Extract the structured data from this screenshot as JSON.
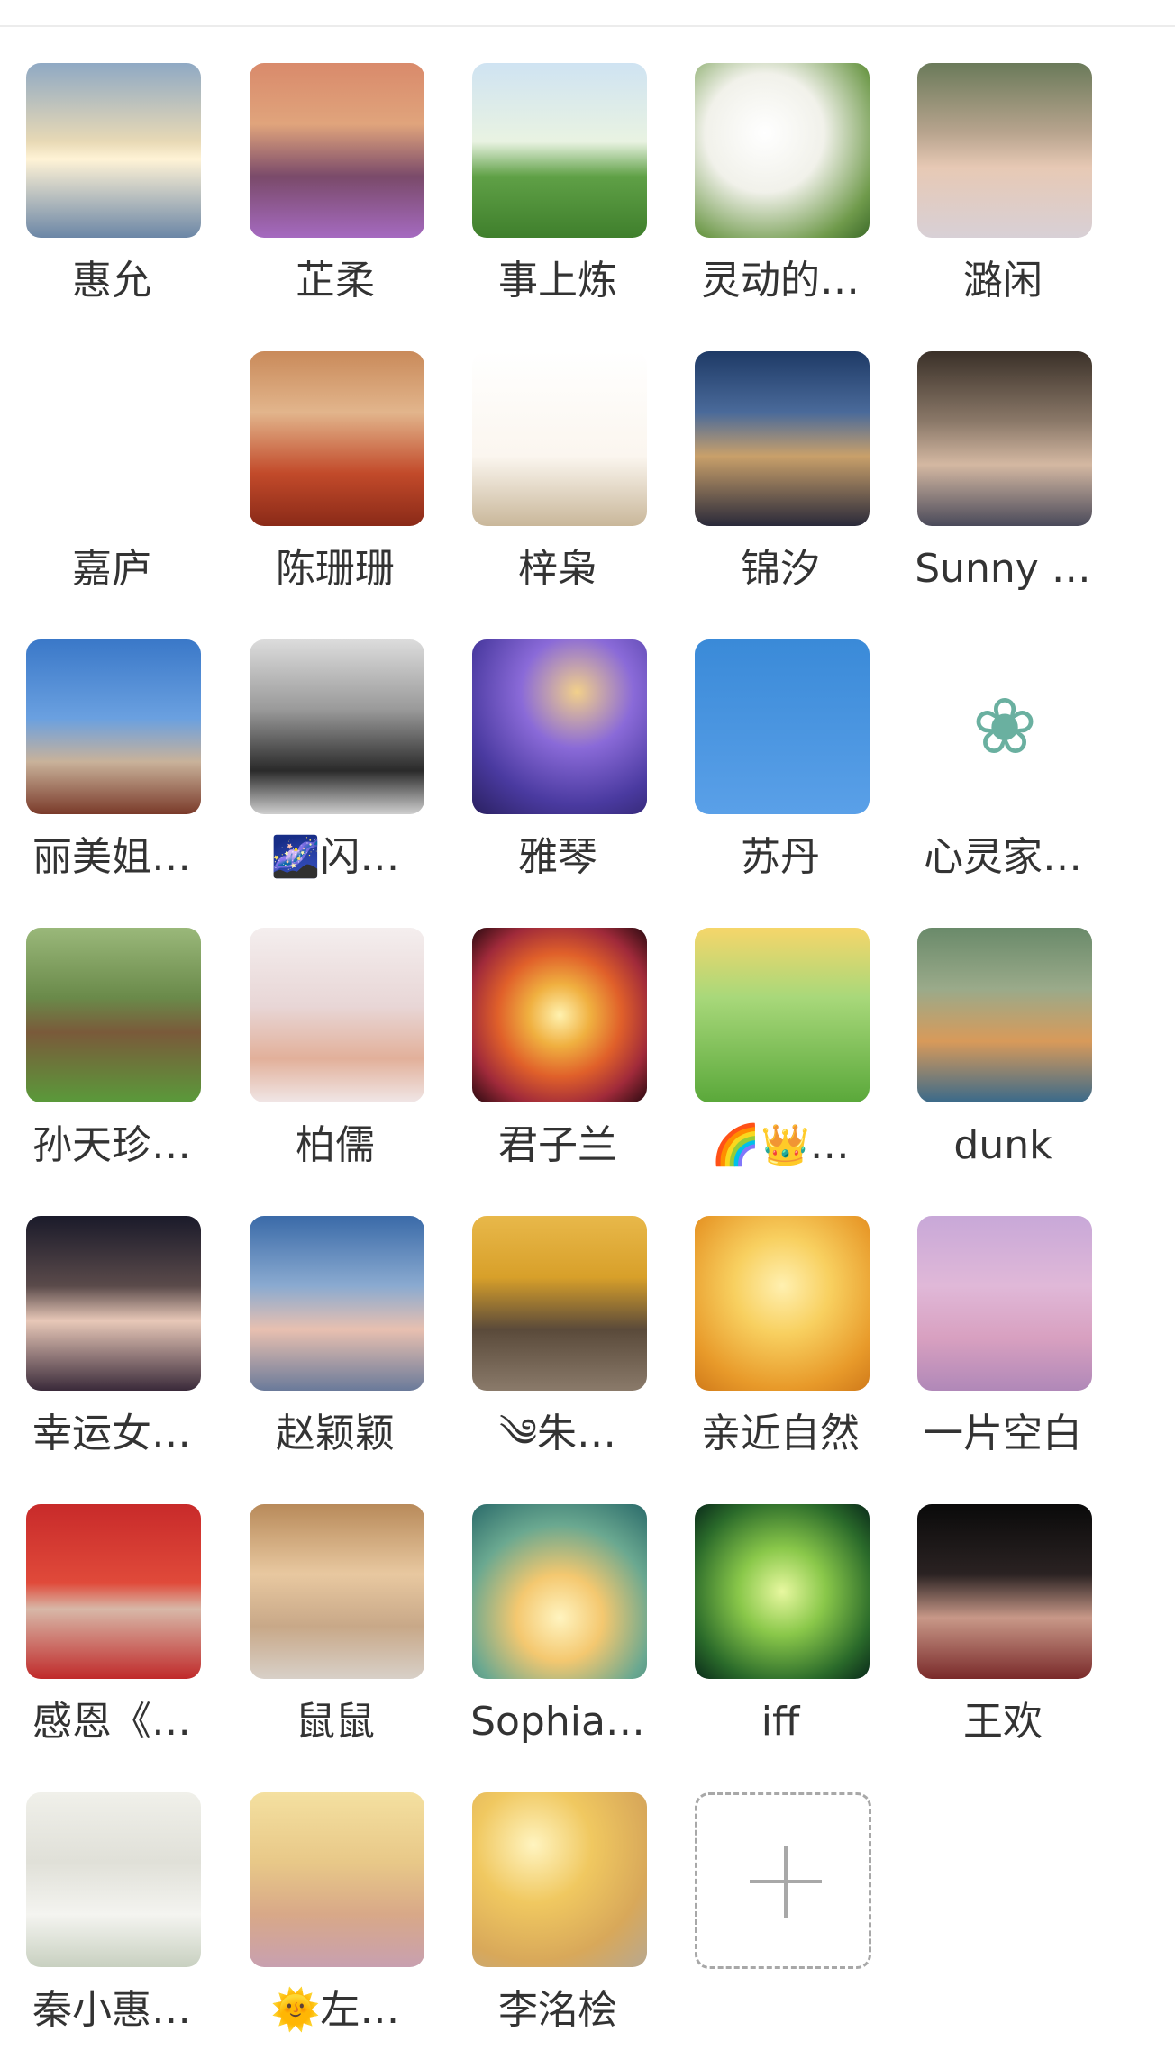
{
  "members": [
    {
      "name": "惠允",
      "icon": "sunlight-clouds-avatar",
      "bg": "linear-gradient(180deg,#8fa9c4 0%,#e8d9b5 45%,#fff3d6 55%,#6b86a6 100%)",
      "glyph": ""
    },
    {
      "name": "芷柔",
      "icon": "woman-sunset-avatar",
      "bg": "linear-gradient(180deg,#d98a6b 0%,#e0a47c 35%,#7a4a6a 65%,#a56ac0 100%)",
      "glyph": ""
    },
    {
      "name": "事上炼",
      "icon": "tree-field-avatar",
      "bg": "linear-gradient(180deg,#cfe3f2 0%,#e9f3e2 45%,#5fa046 65%,#3f7f2c 100%)",
      "glyph": ""
    },
    {
      "name": "灵动的…",
      "icon": "white-flowers-avatar",
      "bg": "radial-gradient(circle at 40% 40%,#ffffff 0%,#f1f1ea 40%,#6f9a4b 80%,#3d6b2a 100%)",
      "glyph": ""
    },
    {
      "name": "潞闲",
      "icon": "woman-portrait-avatar",
      "bg": "linear-gradient(180deg,#6a7a5a 0%,#b8a48e 40%,#e7c9b5 60%,#d8d0d6 100%)",
      "glyph": ""
    },
    {
      "name": "嘉庐",
      "icon": "green-trees-avatar",
      "bg": "linear-gradient(180deg,#ffffff 0%,#ffffff 100%)",
      "glyph": ""
    },
    {
      "name": "陈珊珊",
      "icon": "woman-red-scarf-avatar",
      "bg": "linear-gradient(180deg,#c98a5a 0%,#e2b58c 35%,#c24a2a 70%,#8a2a18 100%)",
      "glyph": ""
    },
    {
      "name": "梓枭",
      "icon": "cartoon-girl-avatar",
      "bg": "linear-gradient(180deg,#ffffff 0%,#fbf6ef 60%,#c9b79a 100%)",
      "glyph": ""
    },
    {
      "name": "锦汐",
      "icon": "mountain-night-avatar",
      "bg": "linear-gradient(180deg,#1e3a66 0%,#4a6a9a 35%,#c9a06a 60%,#2a2a3a 100%)",
      "glyph": ""
    },
    {
      "name": "Sunny …",
      "icon": "woman-glasses-avatar",
      "bg": "linear-gradient(180deg,#3a3028 0%,#8a7868 40%,#d4b8a2 65%,#4a4a5a 100%)",
      "glyph": ""
    },
    {
      "name": "丽美姐…",
      "icon": "woman-sky-avatar",
      "bg": "linear-gradient(180deg,#3a78c8 0%,#6aa0e0 45%,#c9b29a 70%,#7a3a2a 100%)",
      "glyph": ""
    },
    {
      "name": "🌌闪…",
      "icon": "woman-monochrome-avatar",
      "bg": "linear-gradient(180deg,#dcdcdc 0%,#9a9a9a 40%,#2a2a2a 75%,#cfcfcf 100%)",
      "glyph": ""
    },
    {
      "name": "雅琴",
      "icon": "purple-galaxy-avatar",
      "bg": "radial-gradient(circle at 60% 30%,#f2d08a 0%,#8a6ad8 35%,#4a3aa0 70%,#2a2060 100%)",
      "glyph": ""
    },
    {
      "name": "苏丹",
      "icon": "mother-child-cartoon-avatar",
      "bg": "linear-gradient(180deg,#3a8ad8 0%,#5aa0e8 100%)",
      "glyph": ""
    },
    {
      "name": "心灵家…",
      "icon": "flower-of-life-logo-avatar",
      "bg": "linear-gradient(180deg,#ffffff 0%,#ffffff 100%)",
      "glyph": "❀"
    },
    {
      "name": "孙天珍…",
      "icon": "wooden-house-garden-avatar",
      "bg": "linear-gradient(180deg,#9ab87a 0%,#6a8a4a 40%,#7a5a3a 60%,#5a9a3a 100%)",
      "glyph": ""
    },
    {
      "name": "柏儒",
      "icon": "woman-hanfu-fan-avatar",
      "bg": "linear-gradient(180deg,#f4eeee 0%,#e8d6d6 45%,#e2b09a 75%,#f0e6e6 100%)",
      "glyph": ""
    },
    {
      "name": "君子兰",
      "icon": "mandala-avatar",
      "bg": "radial-gradient(circle at 50% 50%,#fff2b0 0%,#f0b040 25%,#e0602a 50%,#a02a3a 75%,#2a0a10 100%)",
      "glyph": ""
    },
    {
      "name": "🌈👑…",
      "icon": "meditating-girl-avatar",
      "bg": "linear-gradient(180deg,#f6d66a 0%,#a8d87a 40%,#5aa83a 100%)",
      "glyph": ""
    },
    {
      "name": "dunk",
      "icon": "corgi-dog-avatar",
      "bg": "linear-gradient(180deg,#6a8a6a 0%,#9aaa8a 35%,#d89a5a 65%,#3a6a8a 100%)",
      "glyph": ""
    },
    {
      "name": "幸运女…",
      "icon": "cartoon-girl-night-avatar",
      "bg": "linear-gradient(180deg,#1a1a2a 0%,#5a4a4a 40%,#e8c8b8 60%,#3a2a3a 100%)",
      "glyph": ""
    },
    {
      "name": "赵颖颖",
      "icon": "sea-pier-avatar",
      "bg": "linear-gradient(180deg,#3a6aa8 0%,#8aaad0 40%,#e8c0b0 65%,#6a7a9a 100%)",
      "glyph": ""
    },
    {
      "name": "༄朱…",
      "icon": "ginkgo-tree-woman-avatar",
      "bg": "linear-gradient(180deg,#e8b84a 0%,#d8a02a 35%,#5a4a3a 65%,#8a7a6a 100%)",
      "glyph": ""
    },
    {
      "name": "亲近自然",
      "icon": "laughing-girl-avatar",
      "bg": "radial-gradient(circle at 50% 40%,#fff0b0 0%,#f8d060 35%,#e89a2a 75%,#d07a1a 100%)",
      "glyph": ""
    },
    {
      "name": "一片空白",
      "icon": "sleeping-baby-avatar",
      "bg": "linear-gradient(180deg,#c8a8d8 0%,#e0b8d8 40%,#d8a0c0 70%,#b088b8 100%)",
      "glyph": ""
    },
    {
      "name": "感恩《…",
      "icon": "woman-red-flag-avatar",
      "bg": "linear-gradient(180deg,#c82a2a 0%,#e04a3a 45%,#d8b8a8 60%,#c02a2a 100%)",
      "glyph": ""
    },
    {
      "name": "鼠鼠",
      "icon": "woman-temple-avatar",
      "bg": "linear-gradient(180deg,#b88a5a 0%,#e8c8a0 40%,#c8a888 70%,#d8d0c8 100%)",
      "glyph": ""
    },
    {
      "name": "Sophia…",
      "icon": "goddess-heart-avatar",
      "bg": "radial-gradient(circle at 50% 65%,#fff4c0 0%,#f4c870 30%,#6aa890 65%,#2a6a6a 100%)",
      "glyph": ""
    },
    {
      "name": "iff",
      "icon": "green-lotus-avatar",
      "bg": "radial-gradient(circle at 50% 50%,#e8f8a0 0%,#8ac84a 35%,#2a6a2a 75%,#0a2a1a 100%)",
      "glyph": ""
    },
    {
      "name": "王欢",
      "icon": "woman-black-background-avatar",
      "bg": "linear-gradient(180deg,#0a0a0a 0%,#2a2222 40%,#c89888 65%,#7a2a2a 100%)",
      "glyph": ""
    },
    {
      "name": "秦小惠…",
      "icon": "cartoon-girl-hanfu-avatar",
      "bg": "linear-gradient(180deg,#f0f0ea 0%,#e0e0d8 40%,#f4f4f0 70%,#c8d0c0 100%)",
      "glyph": ""
    },
    {
      "name": "🌞左…",
      "icon": "smiling-girl-sunlight-avatar",
      "bg": "linear-gradient(180deg,#f4e0a0 0%,#e8c888 40%,#d8a888 70%,#c8a0b0 100%)",
      "glyph": ""
    },
    {
      "name": "李洺桧",
      "icon": "woman-golden-light-avatar",
      "bg": "radial-gradient(circle at 35% 30%,#fff4c0 0%,#f0c860 35%,#d8a85a 70%,#b8a890 100%)",
      "glyph": ""
    }
  ],
  "add_button": {
    "icon": "plus-icon"
  }
}
